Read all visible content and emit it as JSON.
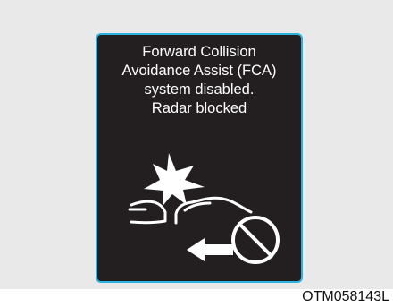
{
  "warning": {
    "lines": [
      "Forward Collision",
      "Avoidance Assist (FCA)",
      "system disabled.",
      "Radar blocked"
    ],
    "icon": "fca-collision-disabled-icon",
    "border_color": "#2bb3e0",
    "background_color": "#231f20"
  },
  "figure_code": "OTM058143L"
}
